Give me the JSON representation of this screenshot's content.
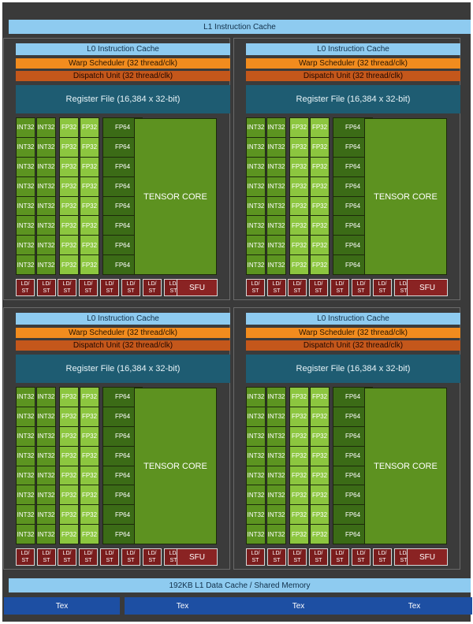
{
  "l1_instruction_cache": "L1 Instruction Cache",
  "quadrant_labels": {
    "l0_instruction_cache": "L0 Instruction Cache",
    "l0_instruction_cache_partial": "L0 Instruction Cache",
    "warp_scheduler": "Warp Scheduler (32 thread/clk)",
    "dispatch_unit": "Dispatch Unit (32 thread/clk)",
    "register_file": "Register File (16,384 x 32-bit)",
    "int32": "INT32",
    "fp32": "FP32",
    "fp64": "FP64",
    "tensor_core": "TENSOR CORE",
    "ld_st": "LD/\nST",
    "sfu": "SFU"
  },
  "rows_per_column": 8,
  "ld_st_units_per_quadrant": 8,
  "l1_data_cache": "192KB L1 Data Cache / Shared Memory",
  "tex_units": [
    "Tex",
    "Tex",
    "Tex",
    "Tex"
  ]
}
